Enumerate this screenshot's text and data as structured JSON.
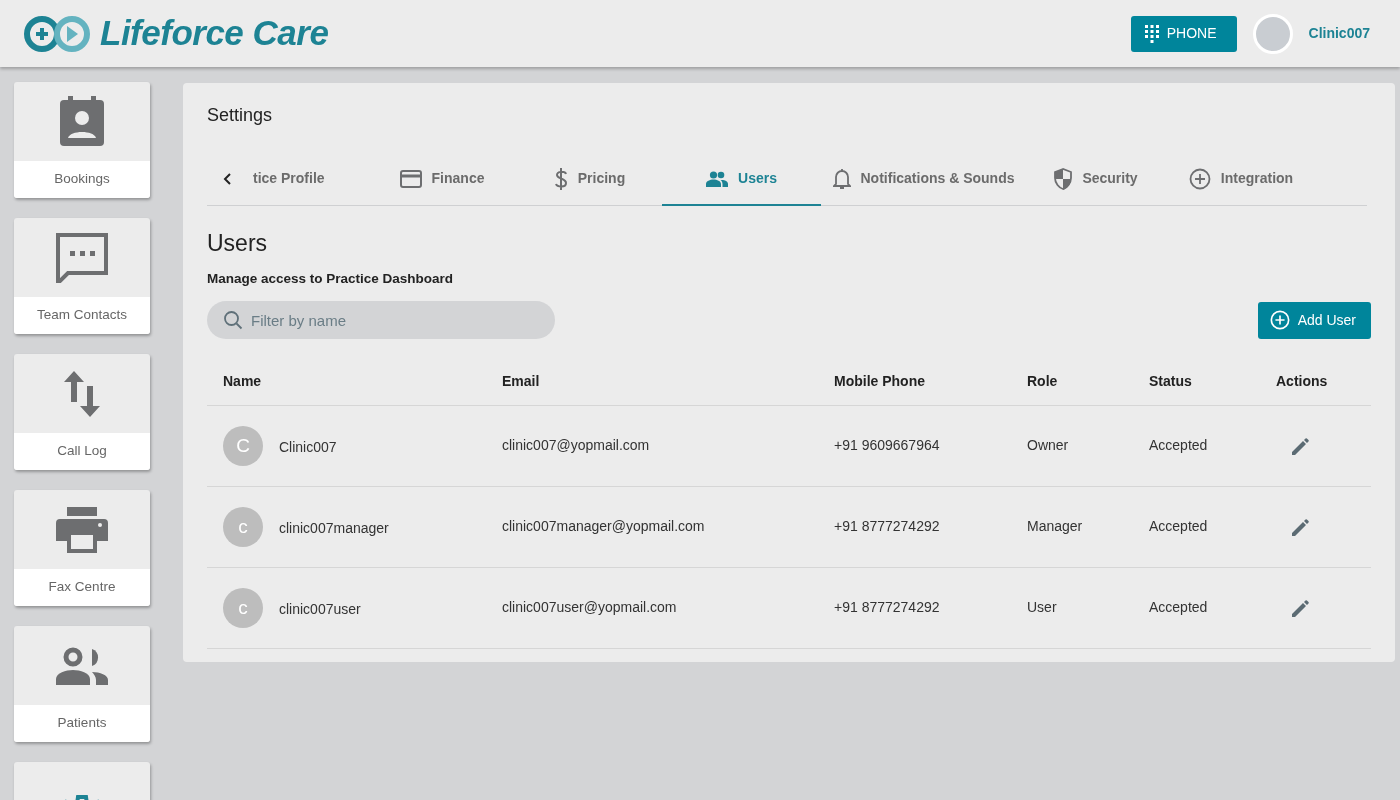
{
  "header": {
    "brand": "Lifeforce Care",
    "phone_button": "PHONE",
    "user": "Clinic007"
  },
  "sidebar": {
    "items": [
      {
        "label": "Bookings",
        "selected": false
      },
      {
        "label": "Team Contacts",
        "selected": false
      },
      {
        "label": "Call Log",
        "selected": false
      },
      {
        "label": "Fax Centre",
        "selected": false
      },
      {
        "label": "Patients",
        "selected": false
      },
      {
        "selected": true
      }
    ]
  },
  "settings": {
    "title": "Settings",
    "tabs": [
      {
        "label": "tice Profile",
        "selected": false
      },
      {
        "label": "Finance",
        "selected": false
      },
      {
        "label": "Pricing",
        "selected": false
      },
      {
        "label": "Users",
        "selected": true
      },
      {
        "label": "Notifications & Sounds",
        "selected": false
      },
      {
        "label": "Security",
        "selected": false
      },
      {
        "label": "Integration",
        "selected": false
      }
    ]
  },
  "users": {
    "title": "Users",
    "subtitle": "Manage access to Practice Dashboard",
    "search": {
      "placeholder": "Filter by name"
    },
    "add_button": "Add User",
    "table": {
      "columns": [
        "Name",
        "Email",
        "Mobile Phone",
        "Role",
        "Status",
        "Actions"
      ],
      "rows": [
        {
          "initial": "C",
          "name": "Clinic007",
          "email": "clinic007@yopmail.com",
          "phone": "+91 9609667964",
          "role": "Owner",
          "status": "Accepted"
        },
        {
          "initial": "c",
          "name": "clinic007manager",
          "email": "clinic007manager@yopmail.com",
          "phone": "+91 8777274292",
          "role": "Manager",
          "status": "Accepted"
        },
        {
          "initial": "c",
          "name": "clinic007user",
          "email": "clinic007user@yopmail.com",
          "phone": "+91 8777274292",
          "role": "User",
          "status": "Accepted"
        }
      ]
    }
  }
}
